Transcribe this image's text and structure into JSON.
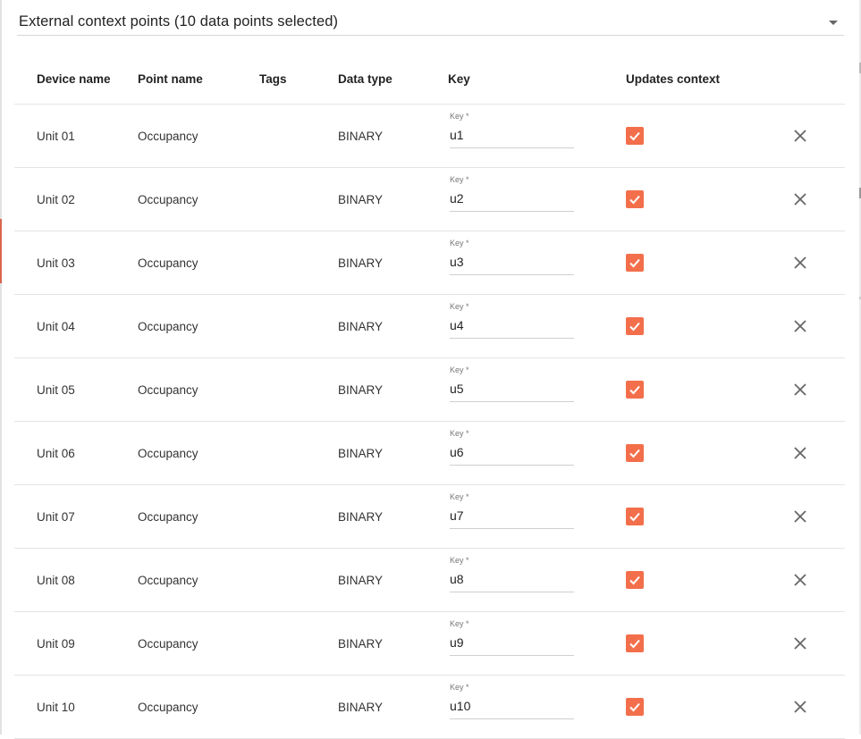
{
  "select": {
    "value": "External context points (10 data points selected)",
    "icon": "chevron-down-icon"
  },
  "table": {
    "headers": {
      "device_name": "Device name",
      "point_name": "Point name",
      "tags": "Tags",
      "data_type": "Data type",
      "key": "Key",
      "updates_context": "Updates context"
    },
    "key_field_label": "Key *",
    "rows": [
      {
        "device": "Unit 01",
        "point": "Occupancy",
        "tags": "",
        "type": "BINARY",
        "key": "u1",
        "updates_context": true
      },
      {
        "device": "Unit 02",
        "point": "Occupancy",
        "tags": "",
        "type": "BINARY",
        "key": "u2",
        "updates_context": true
      },
      {
        "device": "Unit 03",
        "point": "Occupancy",
        "tags": "",
        "type": "BINARY",
        "key": "u3",
        "updates_context": true
      },
      {
        "device": "Unit 04",
        "point": "Occupancy",
        "tags": "",
        "type": "BINARY",
        "key": "u4",
        "updates_context": true
      },
      {
        "device": "Unit 05",
        "point": "Occupancy",
        "tags": "",
        "type": "BINARY",
        "key": "u5",
        "updates_context": true
      },
      {
        "device": "Unit 06",
        "point": "Occupancy",
        "tags": "",
        "type": "BINARY",
        "key": "u6",
        "updates_context": true
      },
      {
        "device": "Unit 07",
        "point": "Occupancy",
        "tags": "",
        "type": "BINARY",
        "key": "u7",
        "updates_context": true
      },
      {
        "device": "Unit 08",
        "point": "Occupancy",
        "tags": "",
        "type": "BINARY",
        "key": "u8",
        "updates_context": true
      },
      {
        "device": "Unit 09",
        "point": "Occupancy",
        "tags": "",
        "type": "BINARY",
        "key": "u9",
        "updates_context": true
      },
      {
        "device": "Unit 10",
        "point": "Occupancy",
        "tags": "",
        "type": "BINARY",
        "key": "u10",
        "updates_context": true
      }
    ]
  },
  "colors": {
    "checkbox_accent": "#f36f4b",
    "divider": "#e4e4e4",
    "remove_icon": "#666666"
  }
}
